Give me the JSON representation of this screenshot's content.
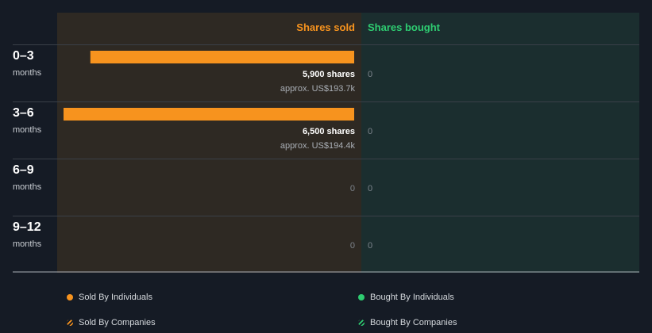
{
  "chart_data": {
    "type": "bar",
    "orientation": "horizontal-diverging",
    "categories": [
      {
        "label": "0–3",
        "sub": "months"
      },
      {
        "label": "3–6",
        "sub": "months"
      },
      {
        "label": "6–9",
        "sub": "months"
      },
      {
        "label": "9–12",
        "sub": "months"
      }
    ],
    "series": [
      {
        "name": "Shares sold",
        "color": "#f7931e",
        "values": [
          5900,
          6500,
          0,
          0
        ],
        "labels": [
          "5,900 shares",
          "6,500 shares",
          "0",
          "0"
        ],
        "approx": [
          "approx. US$193.7k",
          "approx. US$194.4k",
          "",
          ""
        ]
      },
      {
        "name": "Shares bought",
        "color": "#2ecc71",
        "values": [
          0,
          0,
          0,
          0
        ],
        "labels": [
          "0",
          "0",
          "0",
          "0"
        ]
      }
    ],
    "xlim": [
      0,
      6500
    ]
  },
  "legend": [
    {
      "label": "Sold By Individuals",
      "color": "#f7931e",
      "style": "solid"
    },
    {
      "label": "Bought By Individuals",
      "color": "#2ecc71",
      "style": "solid"
    },
    {
      "label": "Sold By Companies",
      "color": "#f7931e",
      "style": "hatched"
    },
    {
      "label": "Bought By Companies",
      "color": "#2ecc71",
      "style": "hatched"
    }
  ],
  "colors": {
    "sold_panel": "#2e2923",
    "bought_panel": "#1b2e2f",
    "gridline": "#3a4048"
  }
}
